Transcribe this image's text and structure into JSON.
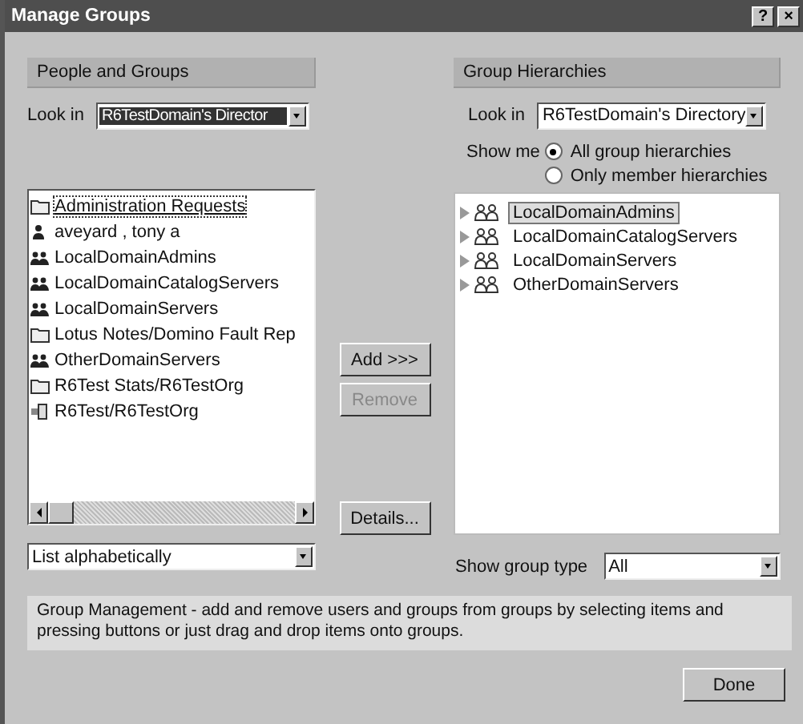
{
  "window": {
    "title": "Manage Groups",
    "controls": [
      "?",
      "×"
    ]
  },
  "left": {
    "header": "People and Groups",
    "look_in_label": "Look in",
    "look_in_value": "R6TestDomain's Director",
    "items": [
      {
        "label": "Administration Requests",
        "kind": "folder",
        "selected": true
      },
      {
        "label": "aveyard , tony a",
        "kind": "person",
        "selected": false
      },
      {
        "label": "LocalDomainAdmins",
        "kind": "group",
        "selected": false
      },
      {
        "label": "LocalDomainCatalogServers",
        "kind": "group",
        "selected": false
      },
      {
        "label": "LocalDomainServers",
        "kind": "group",
        "selected": false
      },
      {
        "label": "Lotus Notes/Domino Fault Rep",
        "kind": "folder",
        "selected": false
      },
      {
        "label": "OtherDomainServers",
        "kind": "group",
        "selected": false
      },
      {
        "label": "R6Test Stats/R6TestOrg",
        "kind": "folder",
        "selected": false
      },
      {
        "label": "R6Test/R6TestOrg",
        "kind": "server",
        "selected": false
      }
    ],
    "sort_value": "List alphabetically"
  },
  "buttons": [
    {
      "label": "Add >>>",
      "disabled": false
    },
    {
      "label": "Remove",
      "disabled": true
    },
    {
      "label": "Details...",
      "disabled": false
    }
  ],
  "right": {
    "header": "Group Hierarchies",
    "look_in_label": "Look in",
    "look_in_value": "R6TestDomain's Directory",
    "show_me_label": "Show me",
    "options": [
      {
        "label": "All group hierarchies",
        "selected": true
      },
      {
        "label": "Only member hierarchies",
        "selected": false
      }
    ],
    "tree": [
      {
        "label": "LocalDomainAdmins",
        "selected": true
      },
      {
        "label": "LocalDomainCatalogServers",
        "selected": false
      },
      {
        "label": "LocalDomainServers",
        "selected": false
      },
      {
        "label": "OtherDomainServers",
        "selected": false
      }
    ],
    "group_type_label": "Show group type",
    "group_type_value": "All"
  },
  "info": "Group Management - add and remove users and groups from groups by selecting items and pressing buttons or just drag and drop items onto groups.",
  "done": "Done"
}
